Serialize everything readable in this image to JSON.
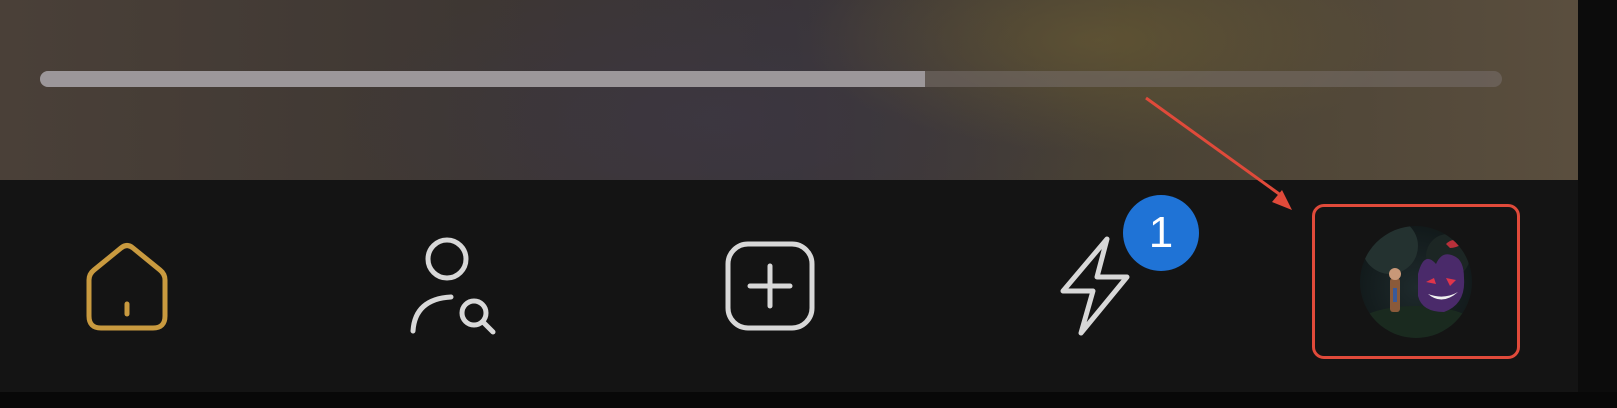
{
  "player": {
    "progress_fraction": 0.605
  },
  "tab_bar": {
    "items": [
      {
        "name": "home",
        "icon": "home-icon",
        "active": true
      },
      {
        "name": "friends",
        "icon": "person-search-icon",
        "active": false
      },
      {
        "name": "create",
        "icon": "plus-square-icon",
        "active": false
      },
      {
        "name": "activity",
        "icon": "lightning-icon",
        "active": false
      },
      {
        "name": "profile",
        "icon": "avatar",
        "active": false
      }
    ],
    "notification_badge": "1"
  },
  "colors": {
    "active_tab": "#c99a3f",
    "inactive_tab": "#d8d8d8",
    "badge": "#1f73d6",
    "annotation": "#e04a3a"
  }
}
